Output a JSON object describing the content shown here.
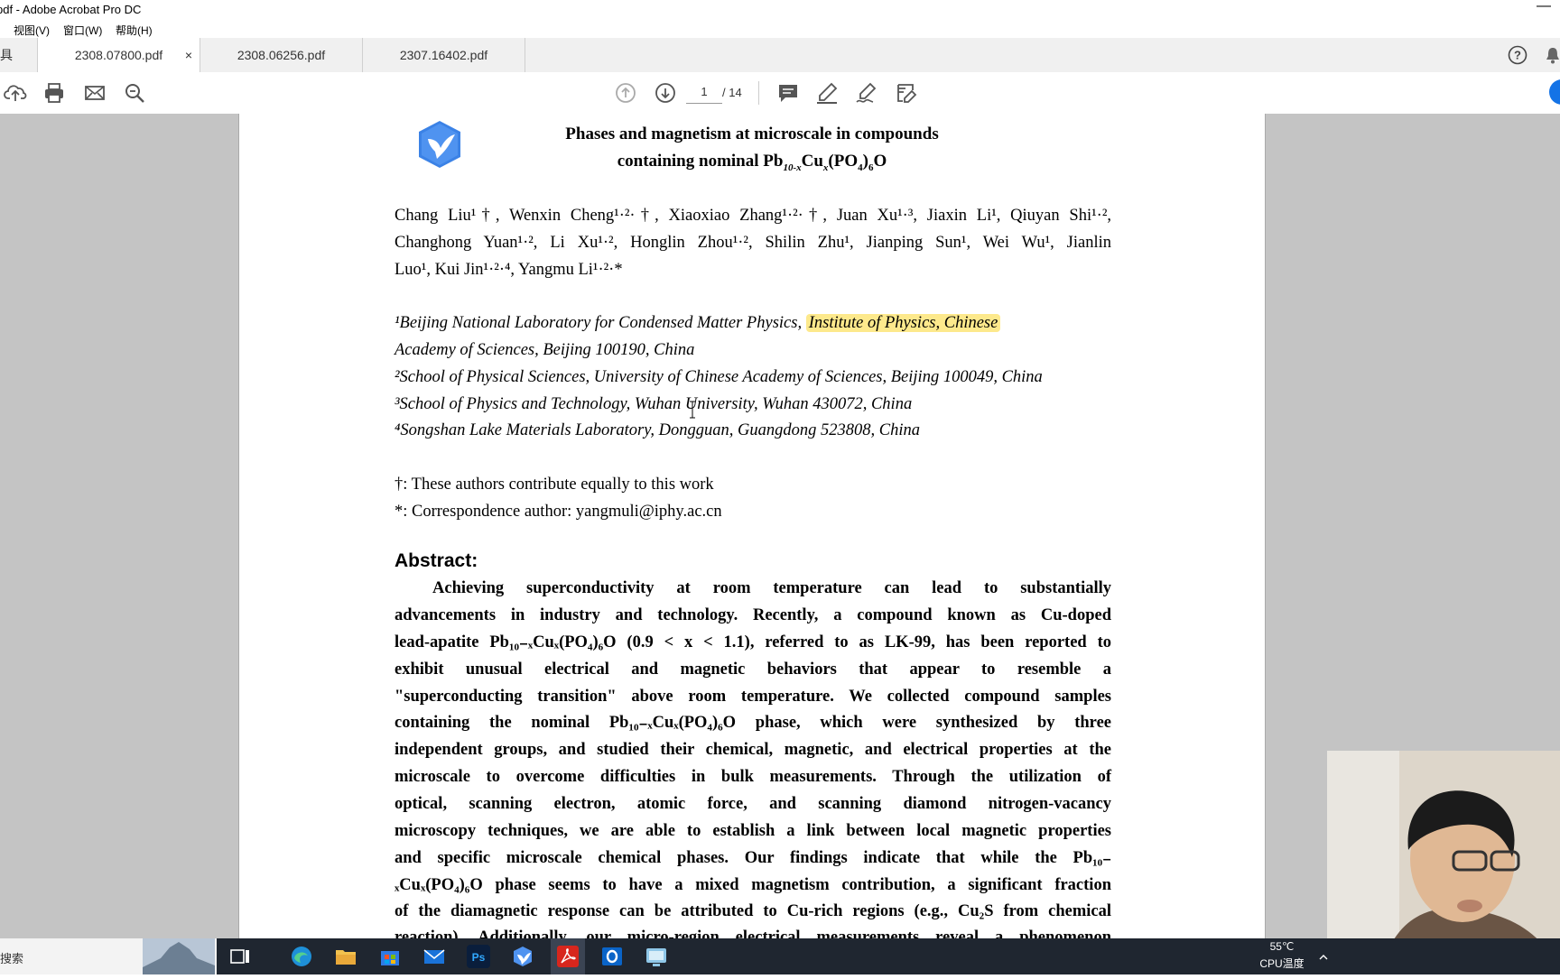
{
  "window": {
    "title": "pdf - Adobe Acrobat Pro DC",
    "minimize": "—"
  },
  "menu": [
    "视图(V)",
    "窗口(W)",
    "帮助(H)"
  ],
  "tools_label": "具",
  "tabs": [
    {
      "label": "2308.07800.pdf",
      "active": true,
      "close": "×"
    },
    {
      "label": "2308.06256.pdf",
      "active": false
    },
    {
      "label": "2307.16402.pdf",
      "active": false
    }
  ],
  "toolbar": {
    "page_current": "1",
    "page_total": "/ 14"
  },
  "paper": {
    "title_line1": "Phases and magnetism at microscale in compounds",
    "title_line2_pre": "containing nominal Pb",
    "title_line2_sub1": "10-x",
    "title_line2_mid": "Cu",
    "title_line2_sub2": "x",
    "title_line2_mid2": "(PO",
    "title_line2_sub3": "4",
    "title_line2_mid3": ")",
    "title_line2_sub4": "6",
    "title_line2_end": "O",
    "authors_line1": "Chang Liu¹†, Wenxin Cheng¹·²·†, Xiaoxiao Zhang¹·²·†, Juan Xu¹·³, Jiaxin Li¹, Qiuyan Shi¹·²,",
    "authors_line2": "Changhong Yuan¹·², Li Xu¹·², Honglin Zhou¹·², Shilin Zhu¹, Jianping Sun¹, Wei Wu¹, Jianlin",
    "authors_line3": "Luo¹, Kui Jin¹·²·⁴, Yangmu Li¹·²·*",
    "aff1_pre": "¹Beijing National Laboratory for Condensed Matter Physics, ",
    "aff1_highlight": "Institute of Physics, Chinese",
    "aff1_cont": "Academy of Sciences, Beijing 100190, China",
    "aff2": "²School of Physical Sciences, University of Chinese Academy of Sciences, Beijing 100049, China",
    "aff3": "³School of Physics and Technology, Wuhan University, Wuhan 430072, China",
    "aff4": "⁴Songshan Lake Materials Laboratory, Dongguan, Guangdong 523808, China",
    "note1": "†: These authors contribute equally to this work",
    "note2": "*: Correspondence author: yangmuli@iphy.ac.cn",
    "abstract_heading": "Abstract:",
    "abstract_lines": [
      "Achieving superconductivity at room temperature can lead to substantially",
      "advancements in industry and technology. Recently, a compound known as Cu-doped",
      "lead-apatite Pb₁₀₋ₓCuₓ(PO₄)₆O (0.9 < x < 1.1), referred to as LK-99, has been reported to",
      "exhibit unusual electrical and magnetic behaviors that appear to resemble a",
      "\"superconducting transition\" above room temperature. We collected compound samples",
      "containing the nominal Pb₁₀₋ₓCuₓ(PO₄)₆O phase, which were synthesized by three",
      "independent groups, and studied their chemical, magnetic, and electrical properties at the",
      "microscale to overcome difficulties in bulk measurements. Through the utilization of",
      "optical, scanning electron, atomic force, and scanning diamond nitrogen-vacancy",
      "microscopy techniques, we are able to establish a link between local magnetic properties",
      "and specific microscale chemical phases. Our findings indicate that while the Pb₁₀₋",
      "ₓCuₓ(PO₄)₆O phase seems to have a mixed magnetism contribution, a significant fraction",
      "of the diamagnetic response can be attributed to Cu-rich regions (e.g., Cu₂S from chemical",
      "reaction). Additionally, our micro-region electrical measurements reveal a phenomenon"
    ]
  },
  "taskbar": {
    "search": "搜索",
    "temp": "55℃",
    "temp_label": "CPU温度"
  },
  "colors": {
    "viewer_bg": "#c4c4c4",
    "highlight": "#fde98c",
    "taskbar": "#1f2630"
  },
  "icons": [
    "upload-icon",
    "print-icon",
    "mail-icon",
    "zoom-icon",
    "page-up-icon",
    "page-down-icon",
    "comment-icon",
    "highlight-pen-icon",
    "sign-icon",
    "edit-form-icon",
    "help-icon",
    "bell-icon",
    "app-logo-icon"
  ]
}
